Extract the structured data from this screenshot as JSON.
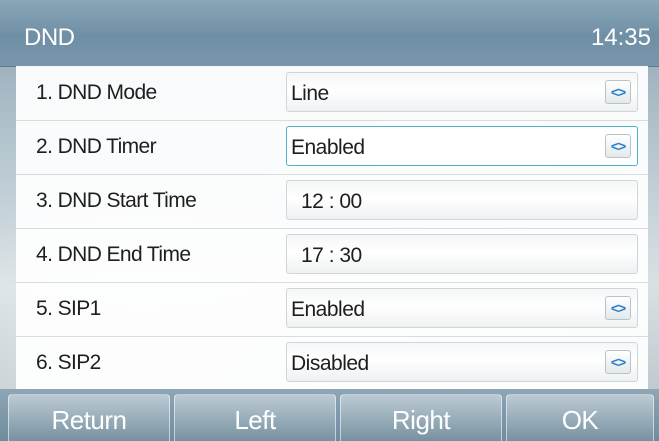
{
  "header": {
    "title": "DND",
    "time": "14:35"
  },
  "rows": [
    {
      "number": "1.",
      "label": "DND Mode",
      "value": "Line",
      "control": "<>"
    },
    {
      "number": "2.",
      "label": "DND Timer",
      "value": "Enabled",
      "control": "<>"
    },
    {
      "number": "3.",
      "label": "DND Start Time",
      "value": "12 : 00"
    },
    {
      "number": "4.",
      "label": "DND End Time",
      "value": "17 : 30"
    },
    {
      "number": "5.",
      "label": "SIP1",
      "value": "Enabled",
      "control": "<>"
    },
    {
      "number": "6.",
      "label": "SIP2",
      "value": "Disabled",
      "control": "<>"
    }
  ],
  "focused_row": 2,
  "softkeys": [
    "Return",
    "Left",
    "Right",
    "OK"
  ],
  "colors": {
    "accent": "#4fb3c8",
    "arrow": "#2b7fc9",
    "titlebar": "#7a97aa"
  },
  "icons": {
    "switch": "left-right-arrows-icon"
  }
}
